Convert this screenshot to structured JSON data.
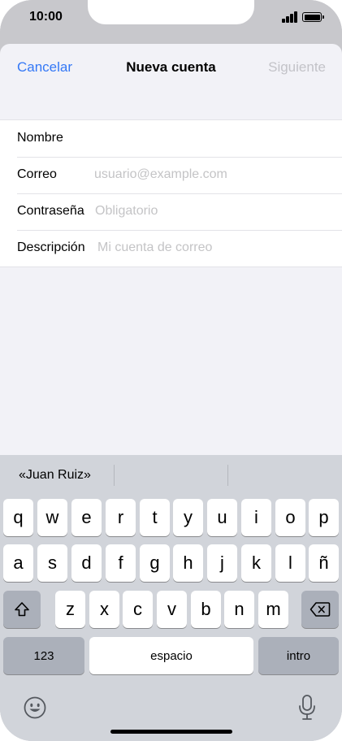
{
  "status_bar": {
    "time": "10:00"
  },
  "nav": {
    "cancel_label": "Cancelar",
    "title": "Nueva cuenta",
    "next_label": "Siguiente"
  },
  "form": {
    "fields": [
      {
        "label": "Nombre",
        "value": "",
        "placeholder": ""
      },
      {
        "label": "Correo",
        "value": "",
        "placeholder": "usuario@example.com"
      },
      {
        "label": "Contraseña",
        "value": "",
        "placeholder": "Obligatorio"
      },
      {
        "label": "Descripción",
        "value": "",
        "placeholder": "Mi cuenta de correo"
      }
    ]
  },
  "keyboard": {
    "suggestions": [
      "«Juan Ruiz»",
      "",
      ""
    ],
    "row1": [
      "q",
      "w",
      "e",
      "r",
      "t",
      "y",
      "u",
      "i",
      "o",
      "p"
    ],
    "row2": [
      "a",
      "s",
      "d",
      "f",
      "g",
      "h",
      "j",
      "k",
      "l",
      "ñ"
    ],
    "row3": [
      "z",
      "x",
      "c",
      "v",
      "b",
      "n",
      "m"
    ],
    "numbers_label": "123",
    "space_label": "espacio",
    "return_label": "intro",
    "icons": {
      "shift": "shift-icon",
      "delete": "delete-icon",
      "emoji": "emoji-icon",
      "dictation": "microphone-icon"
    }
  },
  "colors": {
    "accent": "#3478f6",
    "disabled": "#c3c3c8",
    "placeholder": "#c4c4c6",
    "sheet_background": "#f2f2f7",
    "keyboard_background": "#d1d4da"
  }
}
